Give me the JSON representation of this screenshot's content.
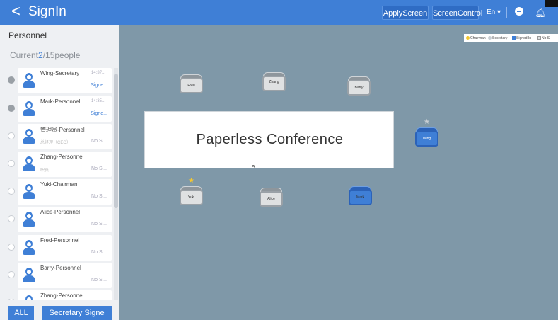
{
  "topbar": {
    "back_label": "<",
    "title": "SignIn",
    "apply_screen": "ApplyScreen",
    "screen_control": "ScreenControl",
    "language": "En ▾"
  },
  "panel": {
    "title": "Personnel",
    "count_prefix": "Current",
    "count_current": "2",
    "count_suffix": "/15people",
    "all_button": "ALL",
    "secretary_button": "Secretary Signe"
  },
  "people": [
    {
      "name": "Wing-Secretary",
      "time": "14:37...",
      "sub": "",
      "status": "Signe...",
      "signed": true
    },
    {
      "name": "Mark-Personnel",
      "time": "14:35...",
      "sub": "",
      "status": "Signe...",
      "signed": true
    },
    {
      "name": "管理员-Personnel",
      "time": "",
      "sub": "总经理（CEO）",
      "status": "No Si...",
      "signed": false
    },
    {
      "name": "Zhang-Personnel",
      "time": "",
      "sub": "职员",
      "status": "No Si...",
      "signed": false
    },
    {
      "name": "Yuki-Chairman",
      "time": "",
      "sub": "",
      "status": "No Si...",
      "signed": false
    },
    {
      "name": "Alice-Personnel",
      "time": "",
      "sub": "",
      "status": "No Si...",
      "signed": false
    },
    {
      "name": "Fred-Personnel",
      "time": "",
      "sub": "",
      "status": "No Si...",
      "signed": false
    },
    {
      "name": "Barry-Personnel",
      "time": "",
      "sub": "",
      "status": "No Si...",
      "signed": false
    },
    {
      "name": "Zhang-Personnel",
      "time": "",
      "sub": "",
      "status": "",
      "signed": false
    }
  ],
  "legend": {
    "chairman": "Chairman",
    "secretary": "Secretary",
    "signed_in": "Signed In",
    "no_sign": "No Si",
    "colors": {
      "chairman": "#f3c630",
      "secretary": "#c8ced3",
      "signed_in": "#3f7fd6",
      "no_sign": "#dfe1e2"
    }
  },
  "screen": {
    "label": "Paperless Conference"
  },
  "seats": {
    "fred": "Fred",
    "zhang": "Zhang",
    "barry": "Barry",
    "wing": "Wing",
    "yuki": "Yuki",
    "alice": "Alice",
    "mark": "Mark"
  },
  "colors": {
    "accent": "#3f7fd6",
    "canvas": "#7f98a8"
  }
}
